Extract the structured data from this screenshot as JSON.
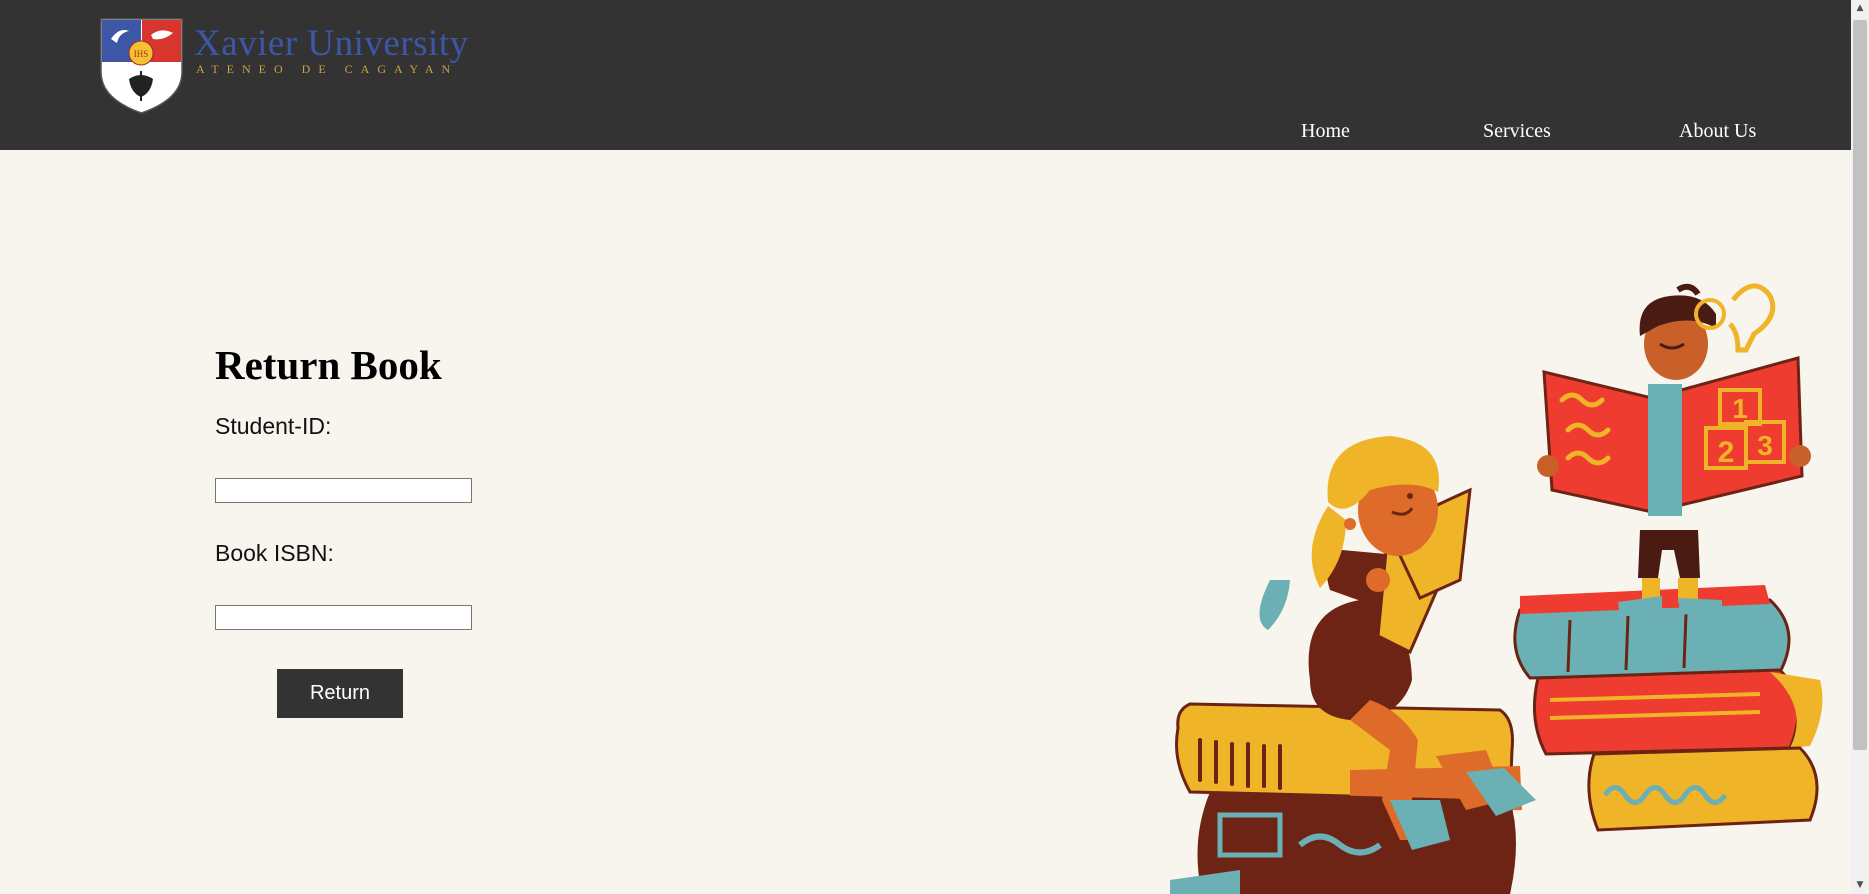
{
  "header": {
    "brand_name": "Xavier University",
    "brand_sub": "ATENEO DE CAGAYAN",
    "logo_icon": "university-crest-icon",
    "background": "#333333",
    "nav": [
      {
        "label": "Home"
      },
      {
        "label": "Services"
      },
      {
        "label": "About Us"
      }
    ]
  },
  "form": {
    "title": "Return Book",
    "student_label": "Student-ID:",
    "student_value": "",
    "isbn_label": "Book ISBN:",
    "isbn_value": "",
    "submit_label": "Return"
  },
  "illustration": {
    "icon": "children-reading-books-illustration",
    "digits": [
      "1",
      "2",
      "3"
    ]
  },
  "colors": {
    "page_bg": "#f8f5ee",
    "accent_blue": "#3c57a8",
    "accent_gold": "#c9a14a",
    "button_bg": "#333333"
  }
}
